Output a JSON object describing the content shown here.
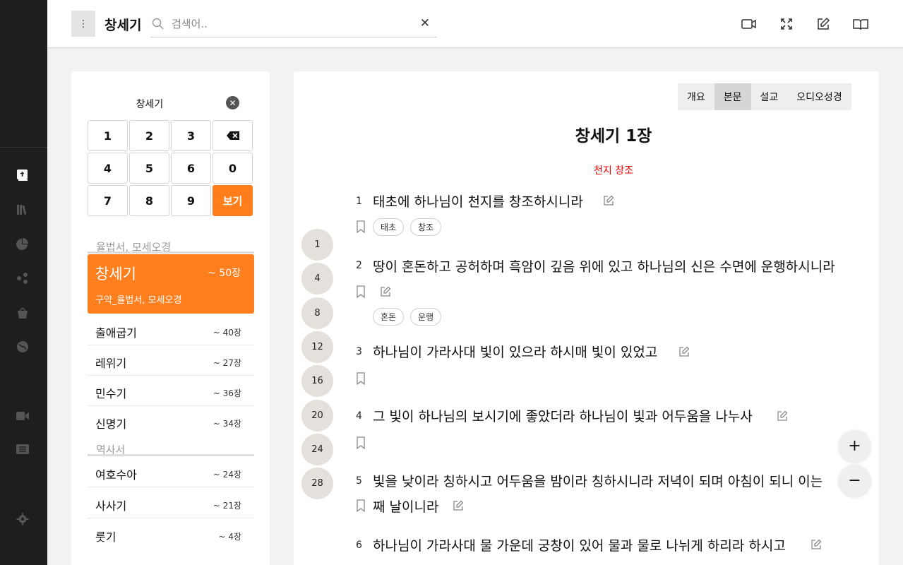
{
  "header": {
    "book_title": "창세기",
    "search_placeholder": "검색어..",
    "clear_label": "✕",
    "menu_label": "⋮"
  },
  "picker": {
    "title": "창세기",
    "keys": [
      "1",
      "2",
      "3",
      "⌫",
      "4",
      "5",
      "6",
      "0",
      "7",
      "8",
      "9",
      "보기"
    ],
    "sections": [
      {
        "label": "율법서, 모세오경"
      },
      {
        "label": "역사서"
      }
    ],
    "active": {
      "name": "창세기",
      "count": "~ 50장",
      "category": "구약_율법서, 모세오경"
    },
    "books_law": [
      {
        "name": "출애굽기",
        "count": "~ 40장"
      },
      {
        "name": "레위기",
        "count": "~ 27장"
      },
      {
        "name": "민수기",
        "count": "~ 36장"
      },
      {
        "name": "신명기",
        "count": "~ 34장"
      }
    ],
    "books_history": [
      {
        "name": "여호수아",
        "count": "~ 24장"
      },
      {
        "name": "사사기",
        "count": "~ 21장"
      },
      {
        "name": "룻기",
        "count": "~ 4장"
      }
    ]
  },
  "tabs": [
    "개요",
    "본문",
    "설교",
    "오디오성경"
  ],
  "active_tab": "본문",
  "chapter": {
    "title": "창세기 1장",
    "section": "천지 창조",
    "jumps": [
      "1",
      "4",
      "8",
      "12",
      "16",
      "20",
      "24",
      "28"
    ],
    "verses": [
      {
        "num": "1",
        "text": "태초에 하나님이 천지를 창조하시니라",
        "tags": [
          "태초",
          "창조"
        ]
      },
      {
        "num": "2",
        "text": "땅이 혼돈하고 공허하며 흑암이 깊음 위에 있고 하나님의 신은 수면에 운행하시니라",
        "tags": [
          "혼돈",
          "운행"
        ]
      },
      {
        "num": "3",
        "text": "하나님이 가라사대 빛이 있으라 하시매 빛이 있었고",
        "tags": []
      },
      {
        "num": "4",
        "text": "그 빛이 하나님의 보시기에 좋았더라 하나님이 빛과 어두움을 나누사",
        "tags": []
      },
      {
        "num": "5",
        "text": "빛을 낮이라 칭하시고 어두움을 밤이라 칭하시니라 저녁이 되며 아침이 되니 이는",
        "text2": "째 날이니라",
        "tags": []
      },
      {
        "num": "6",
        "text": "하나님이 가라사대 물 가운데 궁창이 있어 물과 물로 나뉘게 하리라 하시고",
        "tags": []
      }
    ]
  },
  "fab": {
    "plus": "+",
    "minus": "−"
  },
  "colors": {
    "accent": "#ff7f1f",
    "rail": "#1e1e1e",
    "section_red": "#ee0000"
  }
}
